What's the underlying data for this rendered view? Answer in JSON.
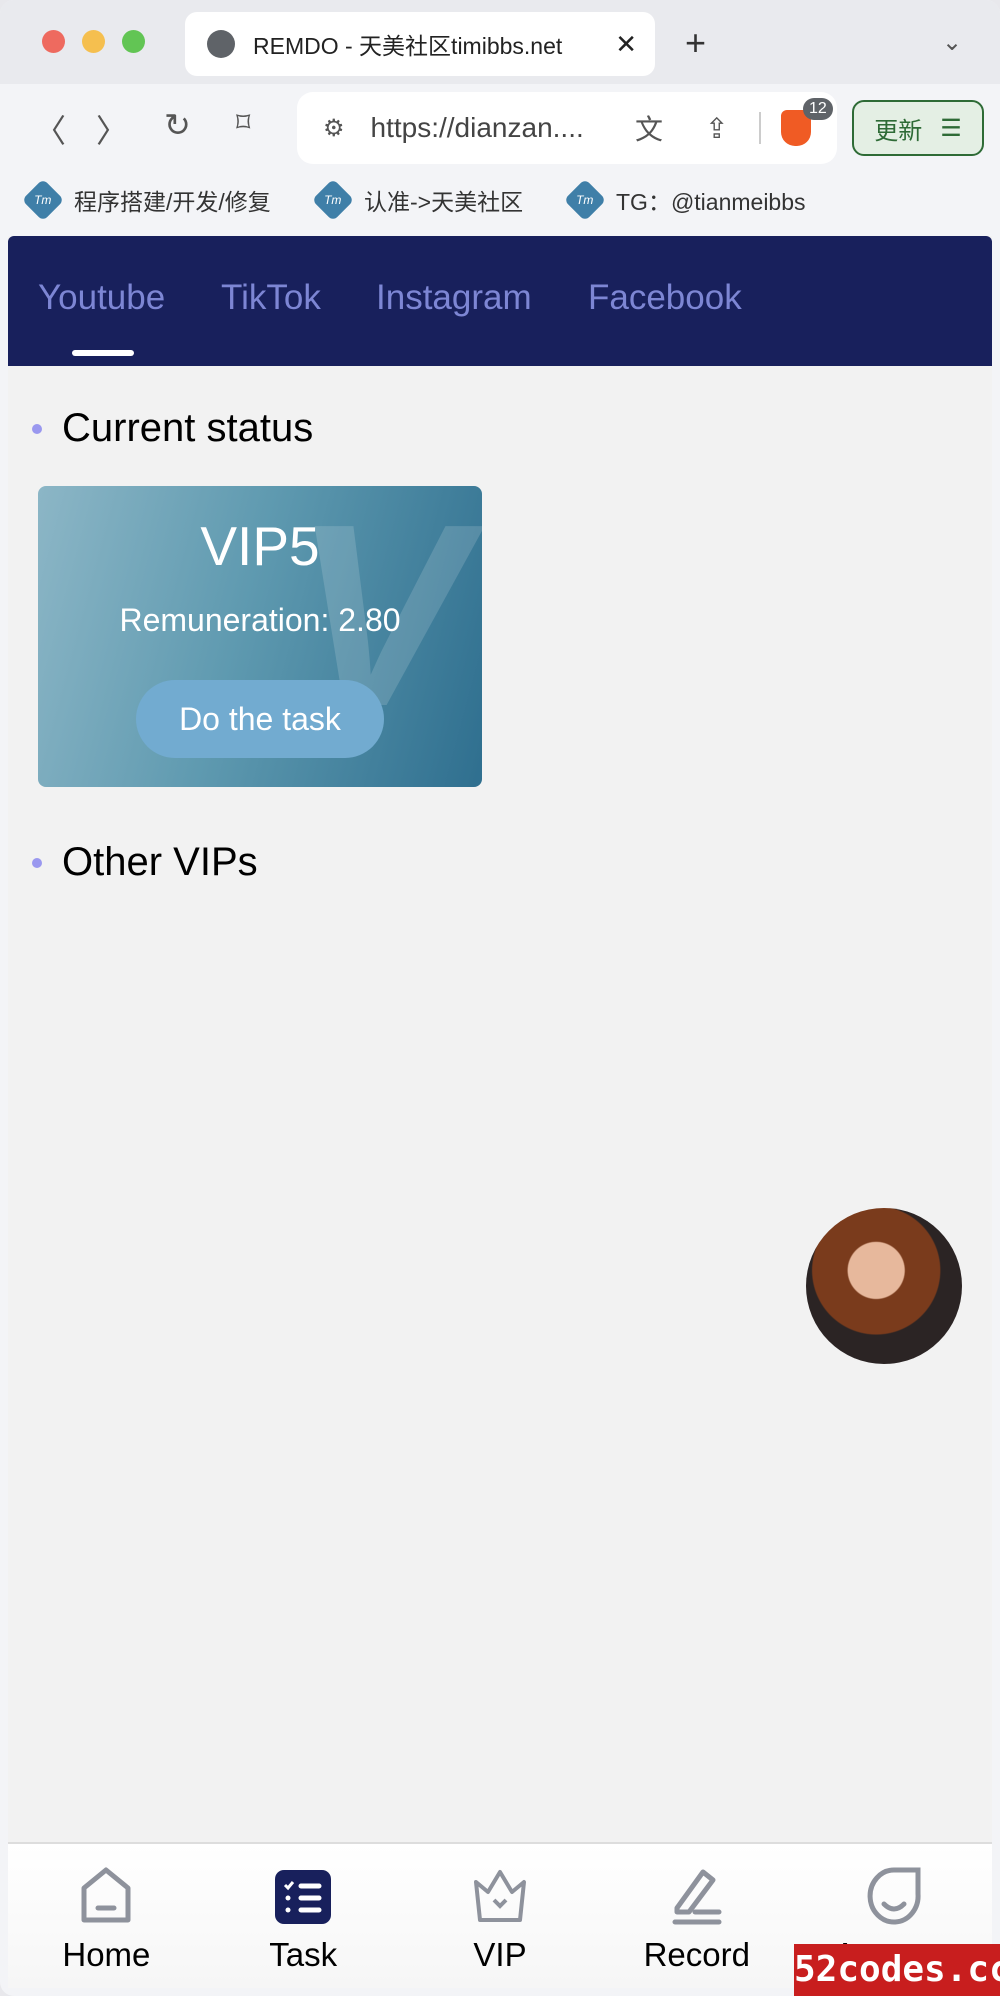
{
  "browser": {
    "tab_title": "REMDO - 天美社区timibbs.net",
    "url": "https://dianzan....",
    "shields_count": "12",
    "update_label": "更新",
    "bookmarks": [
      {
        "label": "程序搭建/开发/修复"
      },
      {
        "label": "认准->天美社区"
      },
      {
        "label": "TG：@tianmeibbs"
      }
    ]
  },
  "nav": {
    "tabs": [
      {
        "label": "Youtube",
        "active": true
      },
      {
        "label": "TikTok"
      },
      {
        "label": "Instagram"
      },
      {
        "label": "Facebook"
      }
    ]
  },
  "current": {
    "heading": "Current status",
    "level": "VIP5",
    "remuneration": "Remuneration: 2.80",
    "button": "Do the task",
    "watermark_letter": "V"
  },
  "other": {
    "heading": "Other VIPs"
  },
  "bottom_nav": [
    {
      "label": "Home",
      "icon": "home-icon"
    },
    {
      "label": "Task",
      "icon": "task-list-icon",
      "active": true
    },
    {
      "label": "VIP",
      "icon": "crown-icon"
    },
    {
      "label": "Record",
      "icon": "pen-icon"
    },
    {
      "label": "Account",
      "icon": "account-icon"
    }
  ],
  "watermark": "52codes.cc",
  "colors": {
    "nav_bg": "#18205c",
    "tab_text": "#7d86d4",
    "accent_dot": "#9a98ef",
    "active_icon": "#18205c",
    "inactive_icon": "#8e929c"
  }
}
